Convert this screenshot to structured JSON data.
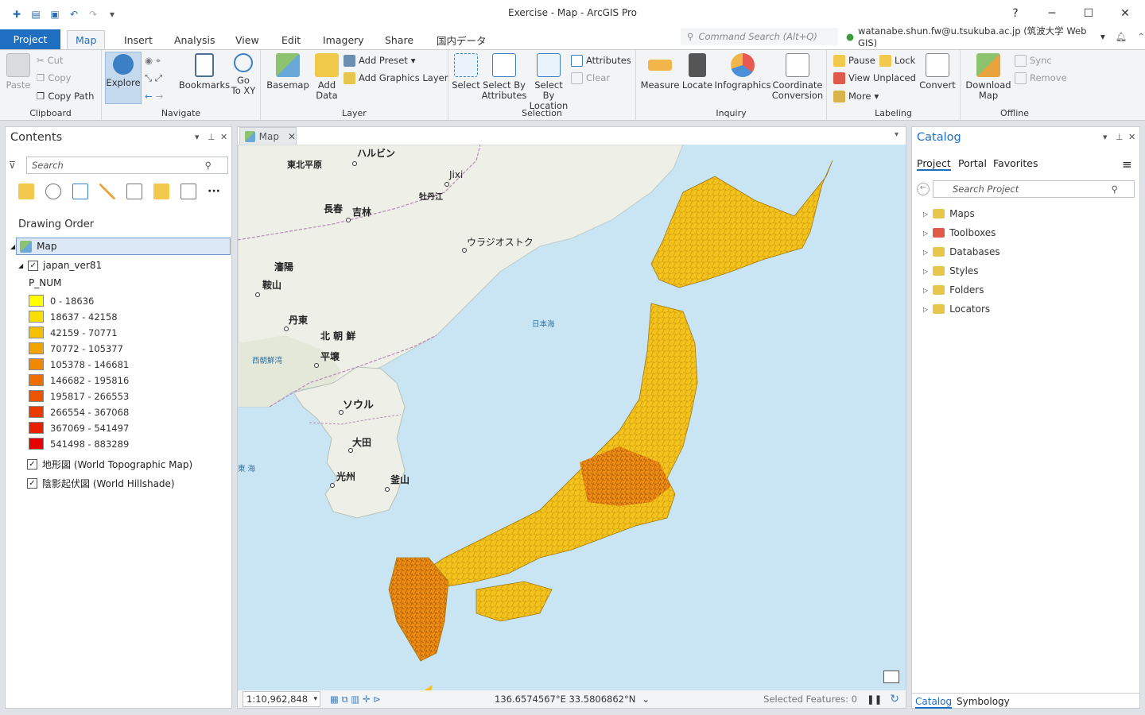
{
  "window": {
    "title": "Exercise - Map - ArcGIS Pro",
    "help": "?",
    "minimize": "─",
    "maximize": "☐",
    "close": "✕"
  },
  "ribbon_tabs": [
    "Project",
    "Map",
    "Insert",
    "Analysis",
    "View",
    "Edit",
    "Imagery",
    "Share",
    "国内データ"
  ],
  "command_search": {
    "placeholder": "Command Search (Alt+Q)"
  },
  "user": {
    "name": "watanabe.shun.fw@u.tsukuba.ac.jp (筑波大学 Web GIS)"
  },
  "groups": {
    "clipboard": {
      "label": "Clipboard",
      "paste": "Paste",
      "cut": "Cut",
      "copy": "Copy",
      "copy_path": "Copy Path"
    },
    "navigate": {
      "label": "Navigate",
      "explore": "Explore",
      "bookmarks": "Bookmarks",
      "goto_line1": "Go",
      "goto_line2": "To XY"
    },
    "layer": {
      "label": "Layer",
      "basemap": "Basemap",
      "add_data_line1": "Add",
      "add_data_line2": "Data",
      "add_preset": "Add Preset",
      "add_graphics": "Add Graphics Layer"
    },
    "selection": {
      "label": "Selection",
      "select": "Select",
      "by_attr_line1": "Select By",
      "by_attr_line2": "Attributes",
      "by_loc_line1": "Select By",
      "by_loc_line2": "Location",
      "attributes": "Attributes",
      "clear": "Clear"
    },
    "inquiry": {
      "label": "Inquiry",
      "measure": "Measure",
      "locate": "Locate",
      "infographics": "Infographics",
      "coord_line1": "Coordinate",
      "coord_line2": "Conversion"
    },
    "labeling": {
      "label": "Labeling",
      "pause": "Pause",
      "lock": "Lock",
      "view_unplaced": "View Unplaced",
      "more": "More",
      "convert": "Convert"
    },
    "offline": {
      "label": "Offline",
      "download_line1": "Download",
      "download_line2": "Map",
      "sync": "Sync",
      "remove": "Remove"
    }
  },
  "contents": {
    "title": "Contents",
    "search_placeholder": "Search",
    "drawing_order": "Drawing Order",
    "map_name": "Map",
    "layer_name": "japan_ver81",
    "field": "P_NUM",
    "classes": [
      {
        "label": "0 - 18636",
        "color": "#ffff00"
      },
      {
        "label": "18637 - 42158",
        "color": "#f8df00"
      },
      {
        "label": "42159 - 70771",
        "color": "#f5c000"
      },
      {
        "label": "70772 - 105377",
        "color": "#f2a300"
      },
      {
        "label": "105378 - 146681",
        "color": "#f08800"
      },
      {
        "label": "146682 - 195816",
        "color": "#ee6e00"
      },
      {
        "label": "195817 - 266553",
        "color": "#ec5500"
      },
      {
        "label": "266554 - 367068",
        "color": "#ea3a00"
      },
      {
        "label": "367069 - 541497",
        "color": "#e81f00"
      },
      {
        "label": "541498 - 883289",
        "color": "#e60000"
      }
    ],
    "basemap1": "地形図 (World Topographic Map)",
    "basemap2": "陰影起伏図 (World Hillshade)"
  },
  "map": {
    "tab_label": "Map",
    "places": [
      {
        "name": "ハルビン"
      },
      {
        "name": "東北平原"
      },
      {
        "name": "Jixi"
      },
      {
        "name": "牡丹江"
      },
      {
        "name": "長春"
      },
      {
        "name": "吉林"
      },
      {
        "name": "ウラジオストク"
      },
      {
        "name": "瀋陽"
      },
      {
        "name": "鞍山"
      },
      {
        "name": "丹東"
      },
      {
        "name": "北 朝 鮮"
      },
      {
        "name": "平壌"
      },
      {
        "name": "ソウル"
      },
      {
        "name": "大田"
      },
      {
        "name": "光州"
      },
      {
        "name": "釜山"
      }
    ],
    "seas": {
      "japan_sea": "日本海",
      "west_korea_bay": "西朝鮮湾",
      "east_sea": "東 海"
    },
    "scale": "1:10,962,848",
    "coords": "136.6574567°E 33.5806862°N",
    "selected": "Selected Features: 0"
  },
  "catalog": {
    "title": "Catalog",
    "tabs": [
      "Project",
      "Portal",
      "Favorites"
    ],
    "search_placeholder": "Search Project",
    "items": [
      "Maps",
      "Toolboxes",
      "Databases",
      "Styles",
      "Folders",
      "Locators"
    ],
    "bottom_tabs": [
      "Catalog",
      "Symbology"
    ]
  }
}
